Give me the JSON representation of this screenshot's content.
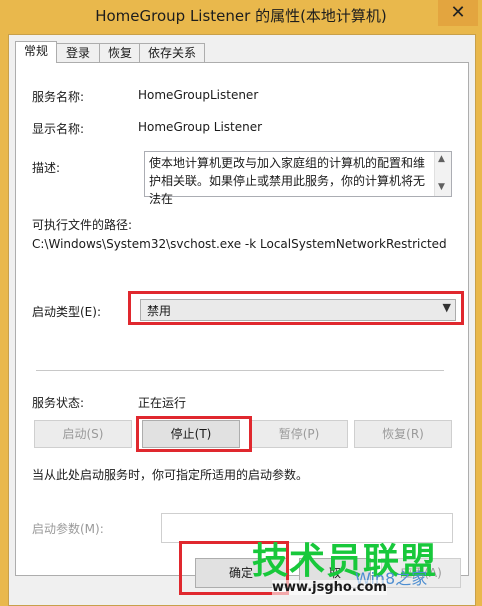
{
  "window": {
    "title": "HomeGroup Listener 的属性(本地计算机)",
    "close_glyph": "✕"
  },
  "tabs": [
    {
      "label": "常规"
    },
    {
      "label": "登录"
    },
    {
      "label": "恢复"
    },
    {
      "label": "依存关系"
    }
  ],
  "general": {
    "service_name_label": "服务名称:",
    "service_name_value": "HomeGroupListener",
    "display_name_label": "显示名称:",
    "display_name_value": "HomeGroup Listener",
    "description_label": "描述:",
    "description_value": "使本地计算机更改与加入家庭组的计算机的配置和维护相关联。如果停止或禁用此服务，你的计算机将无法在",
    "exe_path_label": "可执行文件的路径:",
    "exe_path_value": "C:\\Windows\\System32\\svchost.exe -k LocalSystemNetworkRestricted",
    "startup_type_label": "启动类型(E):",
    "startup_type_value": "禁用",
    "service_status_label": "服务状态:",
    "service_status_value": "正在运行",
    "buttons": {
      "start": "启动(S)",
      "stop": "停止(T)",
      "pause": "暂停(P)",
      "resume": "恢复(R)"
    },
    "hint_text": "当从此处启动服务时，你可指定所适用的启动参数。",
    "start_params_label": "启动参数(M):",
    "start_params_value": ""
  },
  "footer": {
    "ok": "确定",
    "cancel_partial": "取",
    "apply_partial": "应用(A)"
  },
  "watermark": {
    "brand": "技术员联盟",
    "url": "www.jsgho.com",
    "win8_text": "Win8之家"
  },
  "colors": {
    "title_bar": "#e9b84c",
    "highlight_box": "#e0282e",
    "watermark_green": "#18c83b"
  }
}
